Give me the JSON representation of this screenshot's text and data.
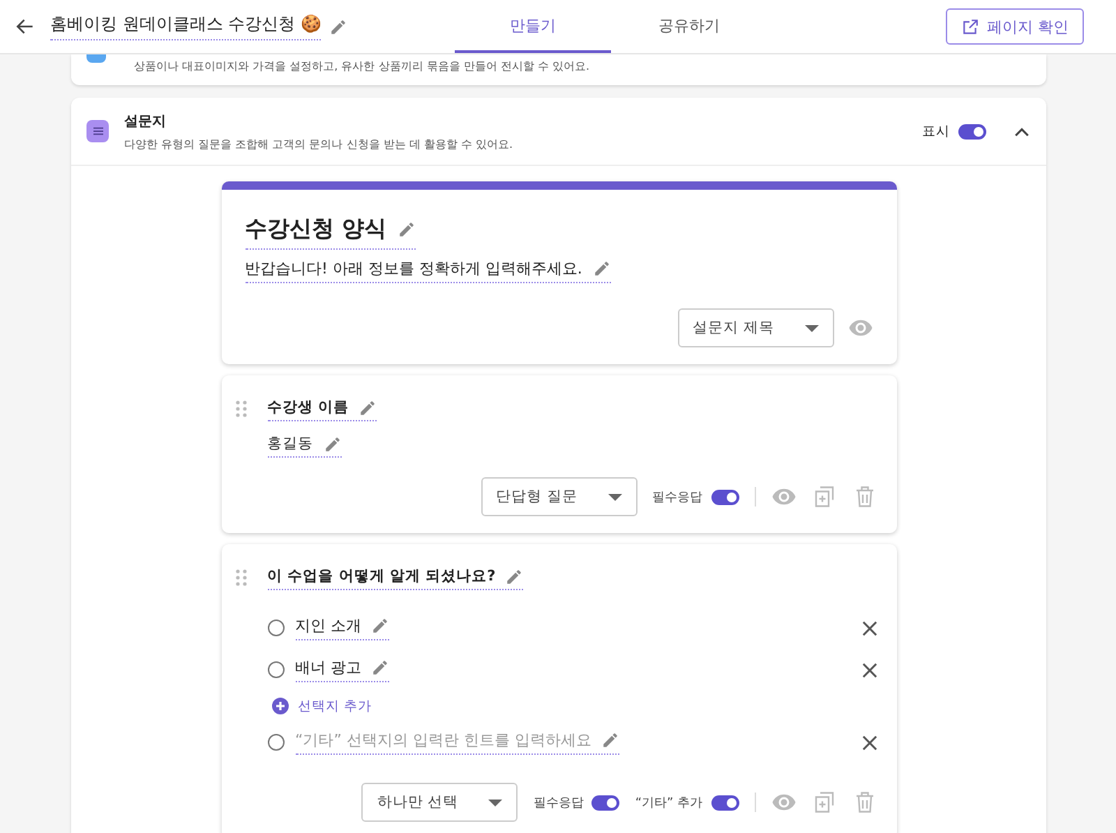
{
  "header": {
    "title": "홈베이킹 원데이클래스 수강신청 🍪",
    "tabs": [
      {
        "label": "만들기",
        "selected": true
      },
      {
        "label": "공유하기",
        "selected": false
      }
    ],
    "preview_button": "페이지 확인"
  },
  "top_card": {
    "description": "상품이나 대표이미지와 가격을 설정하고, 유사한 상품끼리 묶음을 만들어 전시할 수 있어요."
  },
  "section": {
    "title": "설문지",
    "description": "다양한 유형의 질문을 조합해 고객의 문의나 신청을 받는 데 활용할 수 있어요.",
    "display_label": "표시",
    "display_on": true,
    "expanded": true
  },
  "form_header": {
    "title": "수강신청 양식",
    "description": "반갑습니다! 아래 정보를 정확하게 입력해주세요.",
    "select": "설문지 제목"
  },
  "questions": [
    {
      "kind": "short",
      "title": "수강생 이름",
      "answer": "홍길동",
      "type": "단답형 질문",
      "required_label": "필수응답",
      "required": true
    },
    {
      "kind": "choice",
      "title": "이 수업을 어떻게 알게 되셨나요?",
      "options": [
        {
          "kind": "option",
          "label": "지인 소개",
          "selected": false
        },
        {
          "kind": "option",
          "label": "배너 광고",
          "selected": false
        },
        {
          "kind": "add",
          "label": "선택지 추가"
        },
        {
          "kind": "other",
          "label": "“기타” 선택지의 입력란 힌트를 입력하세요",
          "selected": false
        }
      ],
      "type": "하나만 선택",
      "required_label": "필수응답",
      "required": true,
      "other_label": "“기타” 추가",
      "other_on": true
    }
  ]
}
